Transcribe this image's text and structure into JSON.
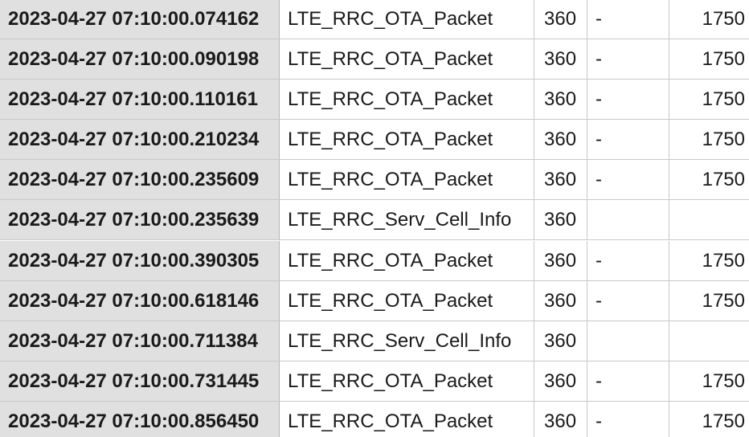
{
  "table": {
    "rows": [
      {
        "timestamp": "2023-04-27 07:10:00.074162",
        "type": "LTE_RRC_OTA_Packet",
        "num": "360",
        "dash": "-",
        "value": "1750"
      },
      {
        "timestamp": "2023-04-27 07:10:00.090198",
        "type": "LTE_RRC_OTA_Packet",
        "num": "360",
        "dash": "-",
        "value": "1750"
      },
      {
        "timestamp": "2023-04-27 07:10:00.110161",
        "type": "LTE_RRC_OTA_Packet",
        "num": "360",
        "dash": "-",
        "value": "1750"
      },
      {
        "timestamp": "2023-04-27 07:10:00.210234",
        "type": "LTE_RRC_OTA_Packet",
        "num": "360",
        "dash": "-",
        "value": "1750"
      },
      {
        "timestamp": "2023-04-27 07:10:00.235609",
        "type": "LTE_RRC_OTA_Packet",
        "num": "360",
        "dash": "-",
        "value": "1750"
      },
      {
        "timestamp": "2023-04-27 07:10:00.235639",
        "type": "LTE_RRC_Serv_Cell_Info",
        "num": "360",
        "dash": "",
        "value": ""
      },
      {
        "timestamp": "2023-04-27 07:10:00.390305",
        "type": "LTE_RRC_OTA_Packet",
        "num": "360",
        "dash": "-",
        "value": "1750"
      },
      {
        "timestamp": "2023-04-27 07:10:00.618146",
        "type": "LTE_RRC_OTA_Packet",
        "num": "360",
        "dash": "-",
        "value": "1750"
      },
      {
        "timestamp": "2023-04-27 07:10:00.711384",
        "type": "LTE_RRC_Serv_Cell_Info",
        "num": "360",
        "dash": "",
        "value": ""
      },
      {
        "timestamp": "2023-04-27 07:10:00.731445",
        "type": "LTE_RRC_OTA_Packet",
        "num": "360",
        "dash": "-",
        "value": "1750"
      },
      {
        "timestamp": "2023-04-27 07:10:00.856450",
        "type": "LTE_RRC_OTA_Packet",
        "num": "360",
        "dash": "-",
        "value": "1750"
      }
    ]
  },
  "colors": {
    "timestamp_column_bg": "#e0e0e0",
    "grid_line": "#c8c8c8",
    "text": "#1a1a1a"
  }
}
